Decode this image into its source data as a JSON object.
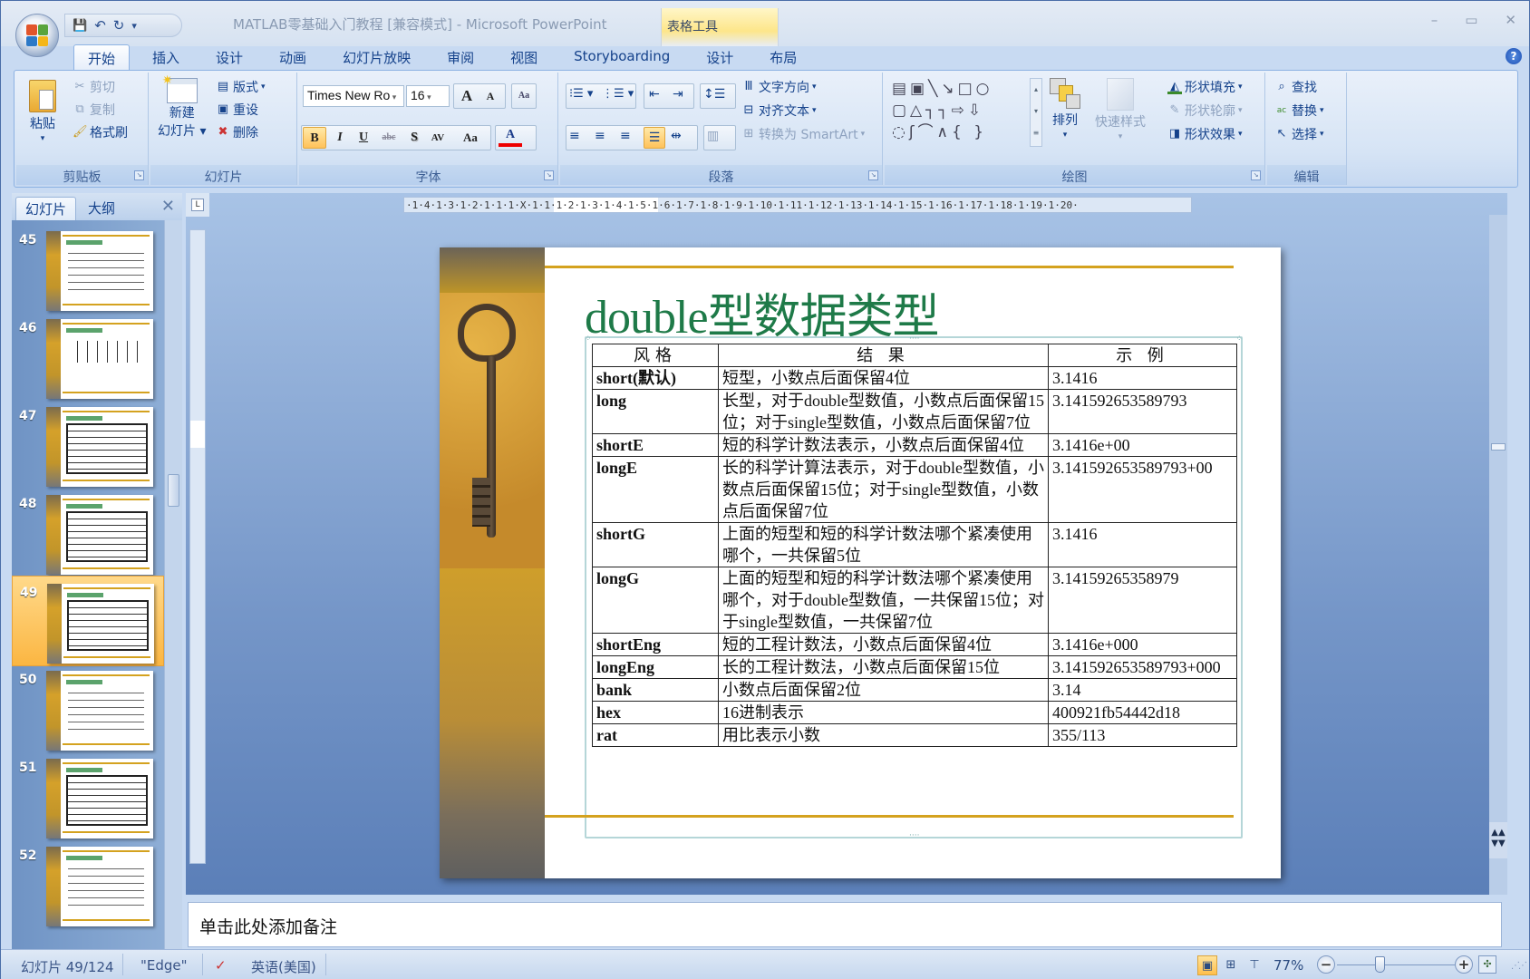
{
  "window": {
    "title": "MATLAB零基础入门教程 [兼容模式] - Microsoft PowerPoint",
    "context_tab_title": "表格工具",
    "controls": {
      "minimize": "–",
      "restore": "▭",
      "close": "✕"
    }
  },
  "quick_access": {
    "save": "💾",
    "undo": "↶",
    "redo": "↻",
    "customize": "▾"
  },
  "tabs": [
    {
      "label": "开始",
      "active": true
    },
    {
      "label": "插入"
    },
    {
      "label": "设计"
    },
    {
      "label": "动画"
    },
    {
      "label": "幻灯片放映"
    },
    {
      "label": "审阅"
    },
    {
      "label": "视图"
    },
    {
      "label": "Storyboarding"
    },
    {
      "label": "设计"
    },
    {
      "label": "布局"
    }
  ],
  "help_icon": "?",
  "ribbon": {
    "clipboard": {
      "label": "剪贴板",
      "paste": "粘贴",
      "cut": "剪切",
      "copy": "复制",
      "format_painter": "格式刷"
    },
    "slides": {
      "label": "幻灯片",
      "new_slide_1": "新建",
      "new_slide_2": "幻灯片",
      "layout": "版式",
      "reset": "重设",
      "delete": "删除"
    },
    "font": {
      "label": "字体",
      "font_name": "Times New Ro",
      "font_size": "16",
      "grow": "A",
      "shrink": "A",
      "clear": "Aa",
      "bold": "B",
      "italic": "I",
      "underline": "U",
      "strike": "abc",
      "shadow": "S",
      "spacing": "AV",
      "case": "Aa",
      "color": "A"
    },
    "paragraph": {
      "label": "段落",
      "text_direction": "文字方向",
      "align_text": "对齐文本",
      "smartart": "转换为 SmartArt"
    },
    "drawing": {
      "label": "绘图",
      "arrange": "排列",
      "quick_styles": "快速样式",
      "shape_fill": "形状填充",
      "shape_outline": "形状轮廓",
      "shape_effects": "形状效果"
    },
    "editing": {
      "label": "编辑",
      "find": "查找",
      "replace": "替换",
      "select": "选择"
    }
  },
  "left_pane": {
    "tab_slides": "幻灯片",
    "tab_outline": "大纲",
    "close": "✕",
    "thumbnails": [
      {
        "number": "45",
        "kind": "text"
      },
      {
        "number": "46",
        "kind": "tree"
      },
      {
        "number": "47",
        "kind": "table"
      },
      {
        "number": "48",
        "kind": "table"
      },
      {
        "number": "49",
        "kind": "table",
        "selected": true
      },
      {
        "number": "50",
        "kind": "text"
      },
      {
        "number": "51",
        "kind": "table"
      },
      {
        "number": "52",
        "kind": "text"
      }
    ]
  },
  "ruler": {
    "h_ticks": "·1·4·1·3·1·2·1·1·1·X·1·1·1·2·1·3·1·4·1·5·1·6·1·7·1·8·1·9·1·10·1·11·1·12·1·13·1·14·1·15·1·16·1·17·1·18·1·19·1·20·"
  },
  "slide": {
    "title": "double型数据类型",
    "table": {
      "headers": [
        "风格",
        "结 果",
        "示 例"
      ],
      "rows": [
        {
          "format": "short(默认)",
          "result": "短型，小数点后面保留4位",
          "example": "3.1416"
        },
        {
          "format": "long",
          "result": "长型，对于double型数值，小数点后面保留15位；对于single型数值，小数点后面保留7位",
          "example": "3.141592653589793"
        },
        {
          "format": "shortE",
          "result": "短的科学计数法表示，小数点后面保留4位",
          "example": "3.1416e+00"
        },
        {
          "format": "longE",
          "result": "长的科学计算法表示，对于double型数值，小数点后面保留15位；对于single型数值，小数点后面保留7位",
          "example": "3.141592653589793+00"
        },
        {
          "format": "shortG",
          "result": "上面的短型和短的科学计数法哪个紧凑使用哪个，一共保留5位",
          "example": "3.1416"
        },
        {
          "format": "longG",
          "result": "上面的短型和短的科学计数法哪个紧凑使用哪个，对于double型数值，一共保留15位；对于single型数值，一共保留7位",
          "example": "3.14159265358979"
        },
        {
          "format": "shortEng",
          "result": "短的工程计数法，小数点后面保留4位",
          "example": "3.1416e+000"
        },
        {
          "format": "longEng",
          "result": "长的工程计数法，小数点后面保留15位",
          "example": "3.141592653589793+000"
        },
        {
          "format": "bank",
          "result": "小数点后面保留2位",
          "example": "3.14"
        },
        {
          "format": "hex",
          "result": "16进制表示",
          "example": "400921fb54442d18"
        },
        {
          "format": "rat",
          "result": "用比表示小数",
          "example": "355/113"
        }
      ]
    }
  },
  "notes": {
    "placeholder": "单击此处添加备注"
  },
  "status_bar": {
    "slide_counter": "幻灯片 49/124",
    "theme": "\"Edge\"",
    "language": "英语(美国)",
    "zoom": "77%",
    "zoom_out": "−",
    "zoom_in": "+",
    "zoom_level_percent": 77
  },
  "colors": {
    "title_green": "#1e7a48",
    "accent_gold": "#d4a21f",
    "ribbon_blue": "#15428b"
  }
}
